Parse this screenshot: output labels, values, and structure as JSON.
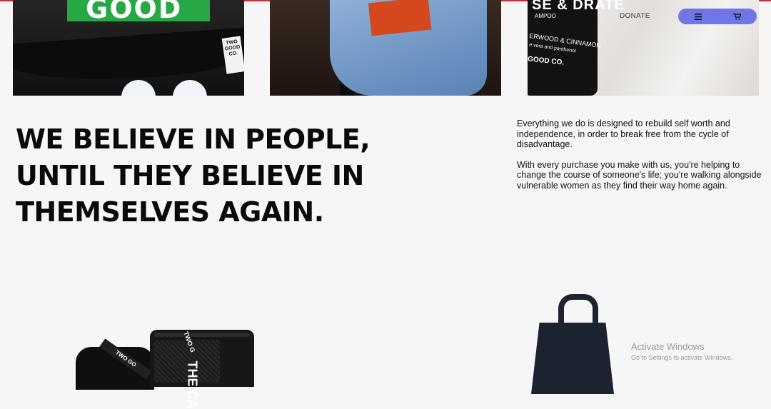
{
  "nav": {
    "donate_label": "DONATE",
    "menu_icon": "hamburger-menu-icon",
    "cart_icon": "cart-icon",
    "accent_color": "#6f77e8"
  },
  "product_images": {
    "book_cover_text": "GOOD",
    "tag_text": "TWO GOOD CO.",
    "bottle": {
      "title": "SE & DRATE",
      "subtitle": "AMPOO",
      "scent": "ERWOOD & CINNAMON",
      "ingredients": "e vera and panthenol",
      "brand": "GOOD CO."
    }
  },
  "headline": {
    "line1": "WE BELIEVE IN PEOPLE,",
    "line2": "UNTIL THEY BELIEVE IN",
    "line3": "THEMSELVES AGAIN."
  },
  "copy": {
    "para1": "Everything we do is designed to rebuild self worth and independence, in order to break free from the cycle of disadvantage.",
    "para2": "With every purchase you make with us, you're helping to change the course of someone's life; you're walking alongside vulnerable women as they find their way home again."
  },
  "bottom_products": {
    "strap_text": "TWO GO",
    "mesh_label": "TWO G",
    "mesh_big_text": "THE CA"
  },
  "watermark": {
    "title": "Activate Windows",
    "subtitle": "Go to Settings to activate Windows."
  }
}
